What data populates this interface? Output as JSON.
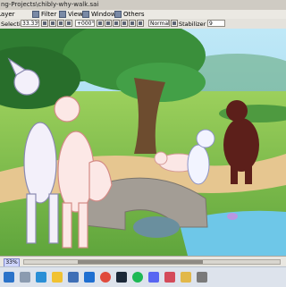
{
  "window": {
    "title": "ng-Projects\\chibly-why-walk.sai"
  },
  "menubar": {
    "items": [
      {
        "label": "Layer",
        "icon": "layer-icon"
      },
      {
        "label": "Filter",
        "icon": "filter-icon"
      },
      {
        "label": "View",
        "icon": "view-icon"
      },
      {
        "label": "Window",
        "icon": "window-icon"
      },
      {
        "label": "Others",
        "icon": "others-icon"
      }
    ]
  },
  "toolbar": {
    "selection_label": "Selection",
    "zoom_value": "33.33%",
    "rotation_value": "+000°",
    "blend_value": "Normal",
    "stabilizer_label": "Stabilizer",
    "stabilizer_value": "9"
  },
  "statusbar": {
    "zoom_badge": "33%",
    "scroll_position": 0.3
  },
  "taskbar": {
    "icons": [
      "start-icon",
      "search-icon",
      "edge-icon",
      "file-explorer-icon",
      "store-icon",
      "mail-icon",
      "chrome-icon",
      "steam-icon",
      "spotify-icon",
      "discord-icon",
      "paint-tool-sai-icon",
      "folder-icon",
      "app-icon"
    ]
  },
  "colors": {
    "sky": "#9ad7ee",
    "grass": "#7fc04f",
    "tree": "#2f7d32",
    "path": "#e6c690",
    "water": "#6ec7e8",
    "bridge": "#a39d95"
  }
}
